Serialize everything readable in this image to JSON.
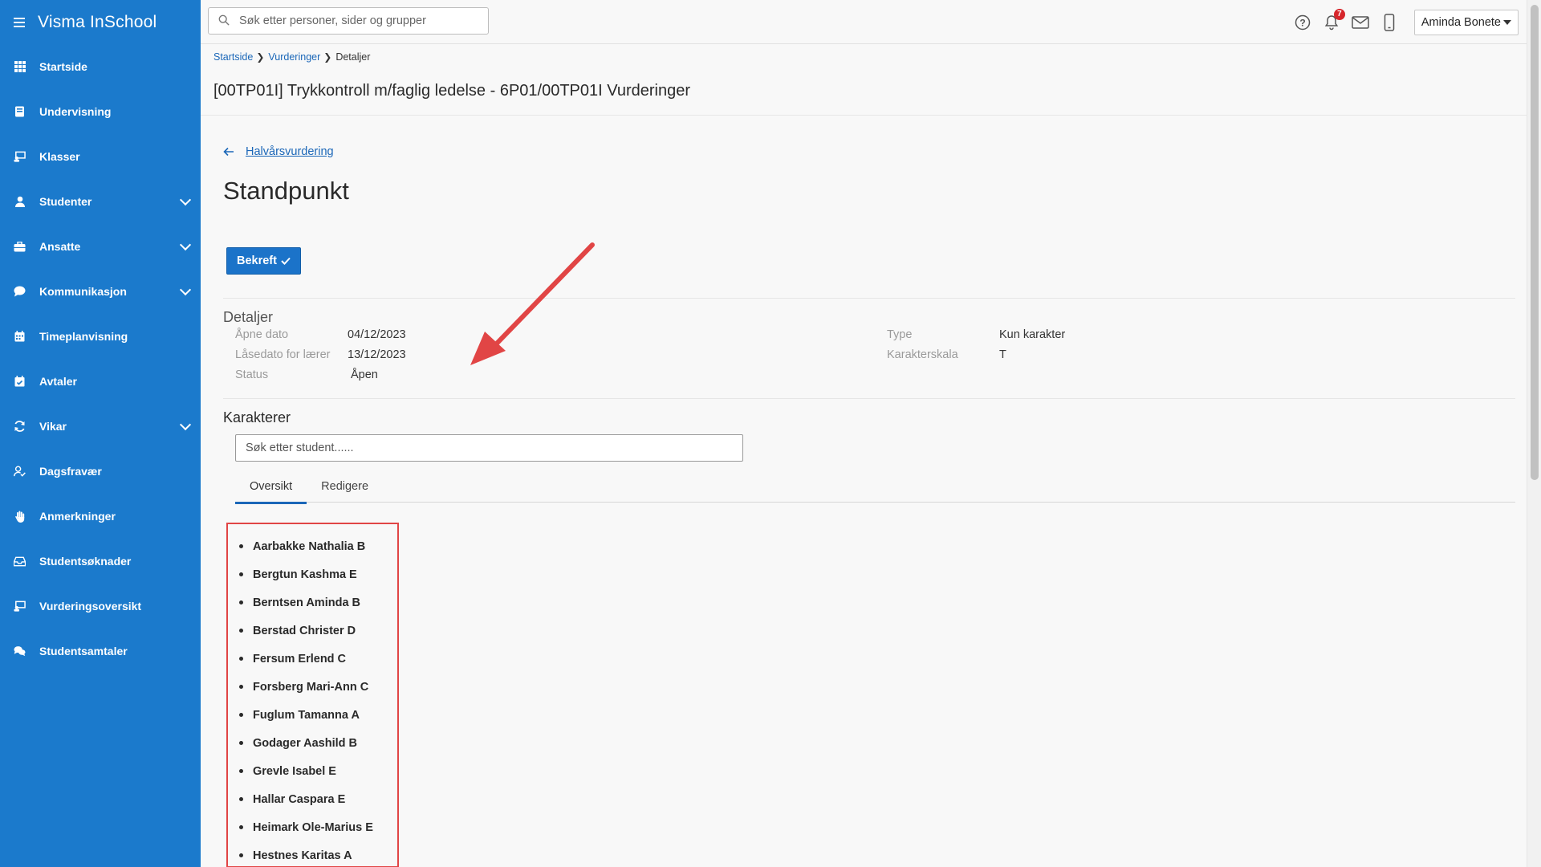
{
  "app": {
    "title": "Visma InSchool"
  },
  "sidebar": {
    "items": [
      {
        "label": "Startside",
        "icon": "grid-icon",
        "expandable": false
      },
      {
        "label": "Undervisning",
        "icon": "book-icon",
        "expandable": false
      },
      {
        "label": "Klasser",
        "icon": "classroom-icon",
        "expandable": false
      },
      {
        "label": "Studenter",
        "icon": "student-icon",
        "expandable": true
      },
      {
        "label": "Ansatte",
        "icon": "briefcase-icon",
        "expandable": true
      },
      {
        "label": "Kommunikasjon",
        "icon": "chat-bubble-icon",
        "expandable": true
      },
      {
        "label": "Timeplanvisning",
        "icon": "calendar-icon",
        "expandable": false
      },
      {
        "label": "Avtaler",
        "icon": "calendar-check-icon",
        "expandable": false
      },
      {
        "label": "Vikar",
        "icon": "refresh-icon",
        "expandable": true
      },
      {
        "label": "Dagsfravær",
        "icon": "user-check-icon",
        "expandable": false
      },
      {
        "label": "Anmerkninger",
        "icon": "hand-icon",
        "expandable": false
      },
      {
        "label": "Studentsøknader",
        "icon": "inbox-icon",
        "expandable": false
      },
      {
        "label": "Vurderingsoversikt",
        "icon": "assessment-icon",
        "expandable": false
      },
      {
        "label": "Studentsamtaler",
        "icon": "conversation-icon",
        "expandable": false
      }
    ]
  },
  "topbar": {
    "search_placeholder": "Søk etter personer, sider og grupper",
    "notification_count": "7",
    "user_name": "Aminda Bonete"
  },
  "breadcrumb": {
    "home": "Startside",
    "parent": "Vurderinger",
    "current": "Detaljer"
  },
  "page_title": "[00TP01I] Trykkontroll m/faglig ledelse - 6P01/00TP01I Vurderinger",
  "back_link": "Halvårsvurdering",
  "section_heading": "Standpunkt",
  "confirm_button": "Bekreft",
  "details": {
    "title": "Detaljer",
    "open_date_label": "Åpne dato",
    "open_date": "04/12/2023",
    "lock_date_label": "Låsedato for lærer",
    "lock_date": "13/12/2023",
    "status_label": "Status",
    "status": "Åpen",
    "type_label": "Type",
    "type": "Kun karakter",
    "scale_label": "Karakterskala",
    "scale": "T"
  },
  "grades": {
    "title": "Karakterer",
    "search_placeholder": "Søk etter student......",
    "tabs": [
      "Oversikt",
      "Redigere"
    ],
    "active_tab": "Oversikt",
    "students": [
      "Aarbakke Nathalia B",
      "Bergtun Kashma E",
      "Berntsen Aminda B",
      "Berstad Christer D",
      "Fersum Erlend C",
      "Forsberg Mari-Ann C",
      "Fuglum Tamanna A",
      "Godager Aashild B",
      "Grevle Isabel E",
      "Hallar Caspara E",
      "Heimark Ole-Marius E",
      "Hestnes Karitas A"
    ]
  },
  "colors": {
    "sidebar": "#1b7acc",
    "primary": "#1b73c9",
    "link": "#1b67b8",
    "highlight": "#e14545"
  }
}
